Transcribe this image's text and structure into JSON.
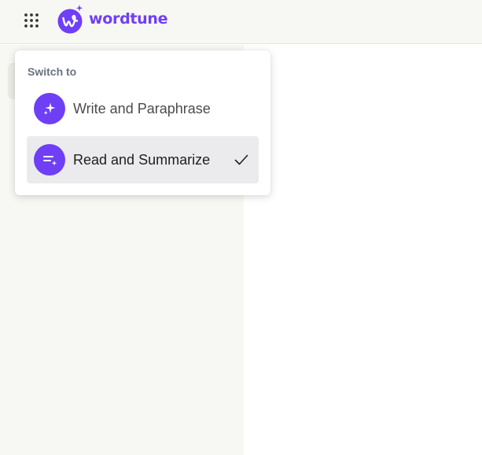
{
  "header": {
    "apps_icon": "grid-dots-icon",
    "logo_icon": "wordtune-w-sparkle-icon",
    "logo_text": "wordtune"
  },
  "switcher": {
    "heading": "Switch to",
    "items": [
      {
        "label": "Write and Paraphrase",
        "icon": "sparkles-icon",
        "selected": false
      },
      {
        "label": "Read and Summarize",
        "icon": "summarize-lines-icon",
        "selected": true
      }
    ],
    "selected_icon": "checkmark-icon"
  },
  "colors": {
    "brand": "#6f3ff5",
    "header_bg": "#f7f7f3",
    "selected_bg": "#ebebee",
    "muted_text": "#6b7280"
  }
}
